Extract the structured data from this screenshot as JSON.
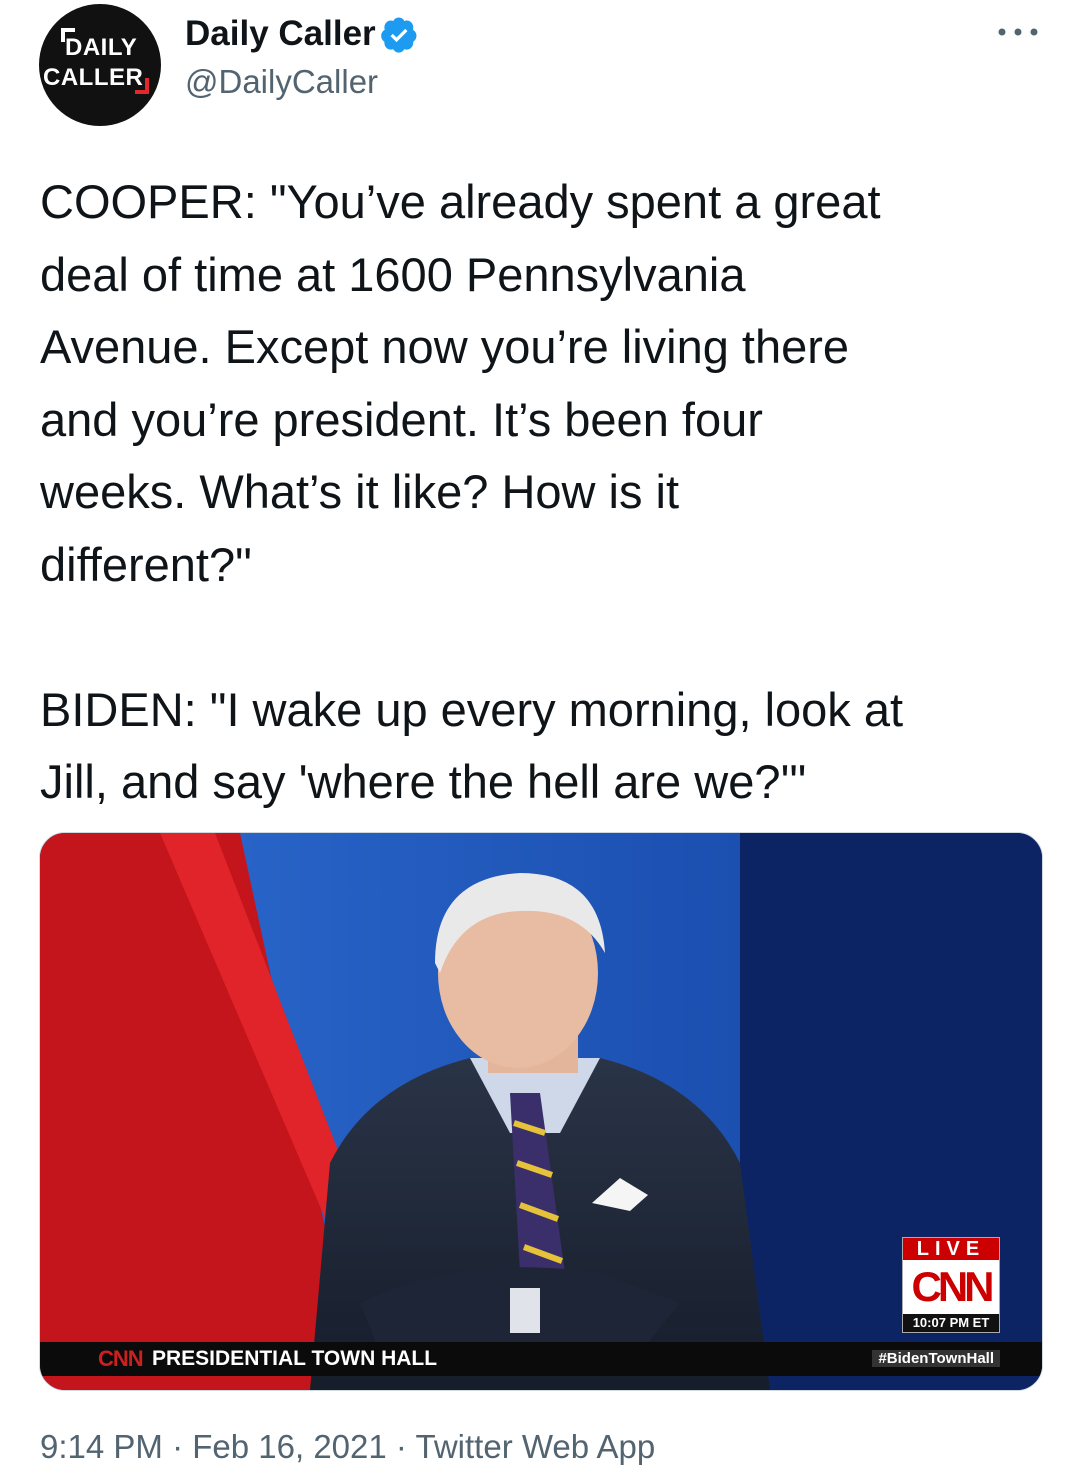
{
  "author": {
    "name": "Daily Caller",
    "handle": "@DailyCaller",
    "verified": true,
    "avatar_logo_lines": [
      "DAILY",
      "CALLER"
    ]
  },
  "tweet": {
    "text": "COOPER: \"You’ve already spent a great\ndeal of time at 1600 Pennsylvania\nAvenue. Except now you’re living there\nand you’re president. It’s been four\nweeks. What’s it like? How is it\ndifferent?\"\n\nBIDEN: \"I wake up every morning, look at\nJill, and say 'where the hell are we?'\""
  },
  "media": {
    "lower_third_logo": "CNN",
    "lower_third_title": "PRESIDENTIAL TOWN HALL",
    "hashtag": "#BidenTownHall",
    "live_label": "LIVE",
    "network": "CNN",
    "broadcast_time": "10:07 PM ET"
  },
  "meta": {
    "time": "9:14 PM",
    "date": "Feb 16, 2021",
    "source": "Twitter Web App",
    "separator": "·"
  },
  "colors": {
    "text": "#0f1419",
    "secondary": "#536471",
    "verified_blue": "#1d9bf0",
    "cnn_red": "#cc0000"
  },
  "icons": {
    "verified": "verified-badge-icon",
    "more": "more-dots-icon"
  }
}
